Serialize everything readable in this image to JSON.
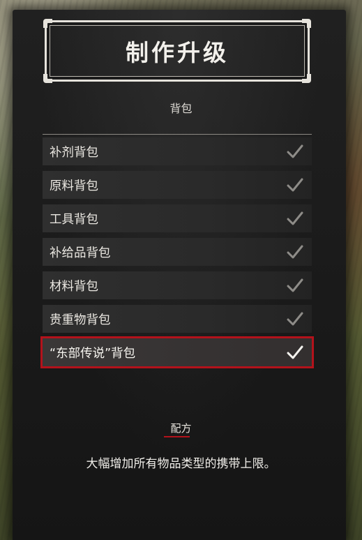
{
  "header": {
    "title": "制作升级",
    "subtitle": "背包"
  },
  "upgrades": [
    {
      "label": "补剂背包",
      "selected": false,
      "crafted": true
    },
    {
      "label": "原料背包",
      "selected": false,
      "crafted": true
    },
    {
      "label": "工具背包",
      "selected": false,
      "crafted": true
    },
    {
      "label": "补给品背包",
      "selected": false,
      "crafted": true
    },
    {
      "label": "材料背包",
      "selected": false,
      "crafted": true
    },
    {
      "label": "贵重物背包",
      "selected": false,
      "crafted": true
    },
    {
      "label": "“东部传说”背包",
      "selected": true,
      "crafted": true
    }
  ],
  "recipe": {
    "label": "配方",
    "description": "大幅增加所有物品类型的携带上限。"
  },
  "colors": {
    "highlight": "#b3121b",
    "check_dim": "#8e8c88",
    "check_active": "#f4f2ee"
  },
  "icons": {
    "check": "check-icon",
    "corner": "corner-ornament-icon"
  }
}
